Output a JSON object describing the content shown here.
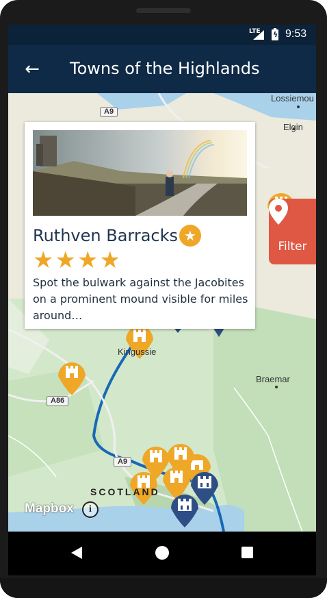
{
  "status": {
    "network": "LTE",
    "time": "9:53"
  },
  "appbar": {
    "title": "Towns of the Highlands",
    "back_icon": "arrow-back-icon"
  },
  "map": {
    "labels": {
      "lossiemouth": "Lossiemou",
      "elgin": "Elgin",
      "kingussie": "Kingussie",
      "braemar": "Braemar",
      "scotland": "SCOTLAND"
    },
    "roads": {
      "a9_top": "A9",
      "a86": "A86",
      "a9_bottom": "A9"
    },
    "attribution": {
      "logo": "Mapbox",
      "info": "i"
    }
  },
  "card": {
    "title": "Ruthven Barracks",
    "badge_icon": "star-badge-icon",
    "rating": 4,
    "rating_max": 4,
    "description": "Spot the bulwark against the Jacobites on a prominent mound visible for miles around…"
  },
  "filter": {
    "label": "Filter",
    "icon": "location-pin-icon"
  },
  "colors": {
    "appbar": "#0f2a47",
    "accent": "#efa728",
    "filter": "#de5844",
    "castle_blue": "#2d4f85"
  }
}
